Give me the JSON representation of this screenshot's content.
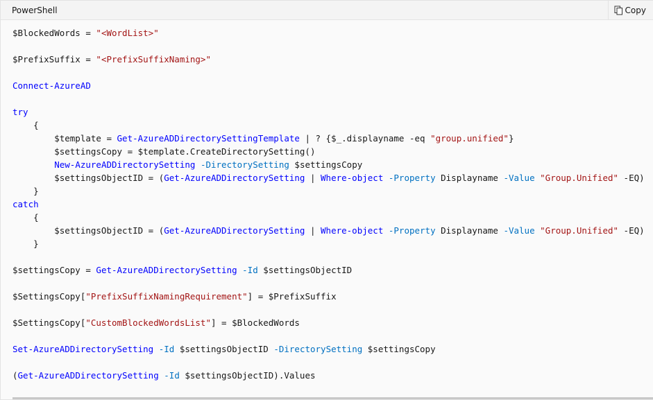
{
  "header": {
    "language": "PowerShell",
    "copy_label": "Copy",
    "copy_icon": "copy-icon"
  },
  "colors": {
    "keyword": "#0101fd",
    "string": "#a31515",
    "parameter": "#0070c1",
    "text": "#171717"
  },
  "code": {
    "lines": [
      [
        {
          "t": "plain",
          "v": "$BlockedWords = "
        },
        {
          "t": "str",
          "v": "\"<WordList>\""
        }
      ],
      [],
      [
        {
          "t": "plain",
          "v": "$PrefixSuffix = "
        },
        {
          "t": "str",
          "v": "\"<PrefixSuffixNaming>\""
        }
      ],
      [],
      [
        {
          "t": "cmd",
          "v": "Connect-AzureAD"
        }
      ],
      [],
      [
        {
          "t": "keyword",
          "v": "try"
        }
      ],
      [
        {
          "t": "plain",
          "v": "    {"
        }
      ],
      [
        {
          "t": "plain",
          "v": "        $template = "
        },
        {
          "t": "cmd",
          "v": "Get-AzureADDirectorySettingTemplate"
        },
        {
          "t": "plain",
          "v": " | ? {$_.displayname -eq "
        },
        {
          "t": "str",
          "v": "\"group.unified\""
        },
        {
          "t": "plain",
          "v": "}"
        }
      ],
      [
        {
          "t": "plain",
          "v": "        $settingsCopy = $template.CreateDirectorySetting()"
        }
      ],
      [
        {
          "t": "plain",
          "v": "        "
        },
        {
          "t": "cmd",
          "v": "New-AzureADDirectorySetting"
        },
        {
          "t": "plain",
          "v": " "
        },
        {
          "t": "param",
          "v": "-DirectorySetting"
        },
        {
          "t": "plain",
          "v": " $settingsCopy"
        }
      ],
      [
        {
          "t": "plain",
          "v": "        $settingsObjectID = ("
        },
        {
          "t": "cmd",
          "v": "Get-AzureADDirectorySetting"
        },
        {
          "t": "plain",
          "v": " | "
        },
        {
          "t": "cmd",
          "v": "Where-object"
        },
        {
          "t": "plain",
          "v": " "
        },
        {
          "t": "param",
          "v": "-Property"
        },
        {
          "t": "plain",
          "v": " Displayname "
        },
        {
          "t": "param",
          "v": "-Value"
        },
        {
          "t": "plain",
          "v": " "
        },
        {
          "t": "str",
          "v": "\"Group.Unified\""
        },
        {
          "t": "plain",
          "v": " -EQ)"
        }
      ],
      [
        {
          "t": "plain",
          "v": "    }"
        }
      ],
      [
        {
          "t": "keyword",
          "v": "catch"
        }
      ],
      [
        {
          "t": "plain",
          "v": "    {"
        }
      ],
      [
        {
          "t": "plain",
          "v": "        $settingsObjectID = ("
        },
        {
          "t": "cmd",
          "v": "Get-AzureADDirectorySetting"
        },
        {
          "t": "plain",
          "v": " | "
        },
        {
          "t": "cmd",
          "v": "Where-object"
        },
        {
          "t": "plain",
          "v": " "
        },
        {
          "t": "param",
          "v": "-Property"
        },
        {
          "t": "plain",
          "v": " Displayname "
        },
        {
          "t": "param",
          "v": "-Value"
        },
        {
          "t": "plain",
          "v": " "
        },
        {
          "t": "str",
          "v": "\"Group.Unified\""
        },
        {
          "t": "plain",
          "v": " -EQ)"
        }
      ],
      [
        {
          "t": "plain",
          "v": "    }"
        }
      ],
      [],
      [
        {
          "t": "plain",
          "v": "$settingsCopy = "
        },
        {
          "t": "cmd",
          "v": "Get-AzureADDirectorySetting"
        },
        {
          "t": "plain",
          "v": " "
        },
        {
          "t": "param",
          "v": "-Id"
        },
        {
          "t": "plain",
          "v": " $settingsObjectID"
        }
      ],
      [],
      [
        {
          "t": "plain",
          "v": "$SettingsCopy["
        },
        {
          "t": "str",
          "v": "\"PrefixSuffixNamingRequirement\""
        },
        {
          "t": "plain",
          "v": "] = $PrefixSuffix"
        }
      ],
      [],
      [
        {
          "t": "plain",
          "v": "$SettingsCopy["
        },
        {
          "t": "str",
          "v": "\"CustomBlockedWordsList\""
        },
        {
          "t": "plain",
          "v": "] = $BlockedWords"
        }
      ],
      [],
      [
        {
          "t": "cmd",
          "v": "Set-AzureADDirectorySetting"
        },
        {
          "t": "plain",
          "v": " "
        },
        {
          "t": "param",
          "v": "-Id"
        },
        {
          "t": "plain",
          "v": " $settingsObjectID "
        },
        {
          "t": "param",
          "v": "-DirectorySetting"
        },
        {
          "t": "plain",
          "v": " $settingsCopy"
        }
      ],
      [],
      [
        {
          "t": "plain",
          "v": "("
        },
        {
          "t": "cmd",
          "v": "Get-AzureADDirectorySetting"
        },
        {
          "t": "plain",
          "v": " "
        },
        {
          "t": "param",
          "v": "-Id"
        },
        {
          "t": "plain",
          "v": " $settingsObjectID).Values"
        }
      ]
    ]
  }
}
